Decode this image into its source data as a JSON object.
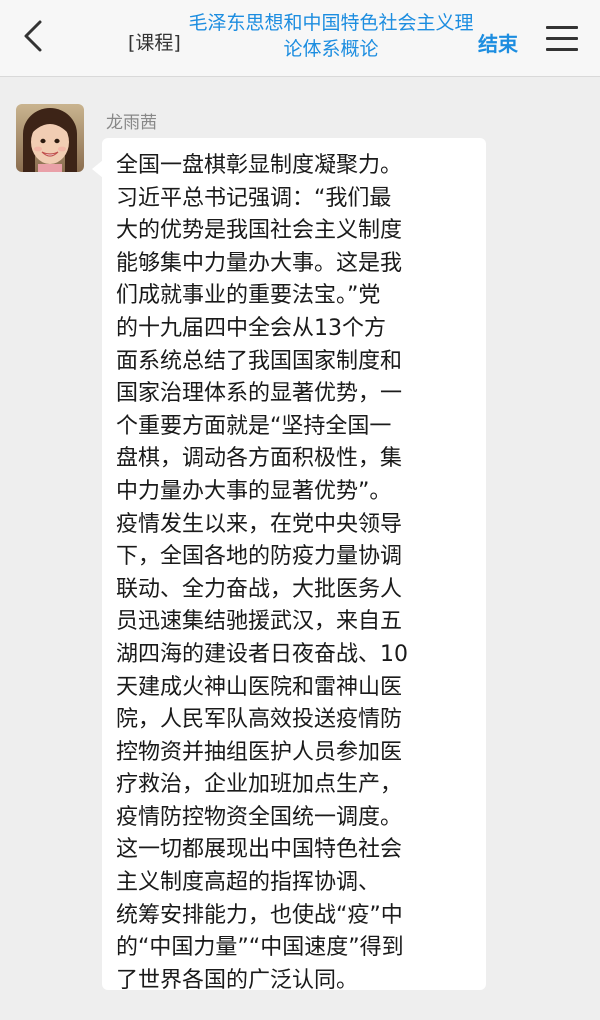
{
  "header": {
    "course_tag": "[课程]",
    "course_title": "毛泽东思想和中国特色社会主义理论体系概论",
    "end_label": "结束",
    "back_icon": "chevron-left-icon",
    "menu_icon": "hamburger-menu-icon"
  },
  "message": {
    "sender": "龙雨茜",
    "text": "全国一盘棋彰显制度凝聚力。\n习近平总书记强调：“我们最\n大的优势是我国社会主义制度\n能够集中力量办大事。这是我\n们成就事业的重要法宝。”党\n的十九届四中全会从13个方\n面系统总结了我国国家制度和\n国家治理体系的显著优势，一\n个重要方面就是“坚持全国一\n盘棋，调动各方面积极性，集\n中力量办大事的显著优势”。\n疫情发生以来，在党中央领导\n下，全国各地的防疫力量协调\n联动、全力奋战，大批医务人\n员迅速集结驰援武汉，来自五\n湖四海的建设者日夜奋战、10\n天建成火神山医院和雷神山医\n院，人民军队高效投送疫情防\n控物资并抽组医护人员参加医\n疗救治，企业加班加点生产，\n疫情防控物资全国统一调度。\n这一切都展现出中国特色社会\n主义制度高超的指挥协调、\n统筹安排能力，也使战“疫”中\n的“中国力量”“中国速度”得到\n了世界各国的广泛认同。"
  },
  "colors": {
    "accent": "#1c8de0",
    "header_bg": "#f7f7f7",
    "page_bg": "#eeeeee",
    "bubble_bg": "#ffffff"
  }
}
